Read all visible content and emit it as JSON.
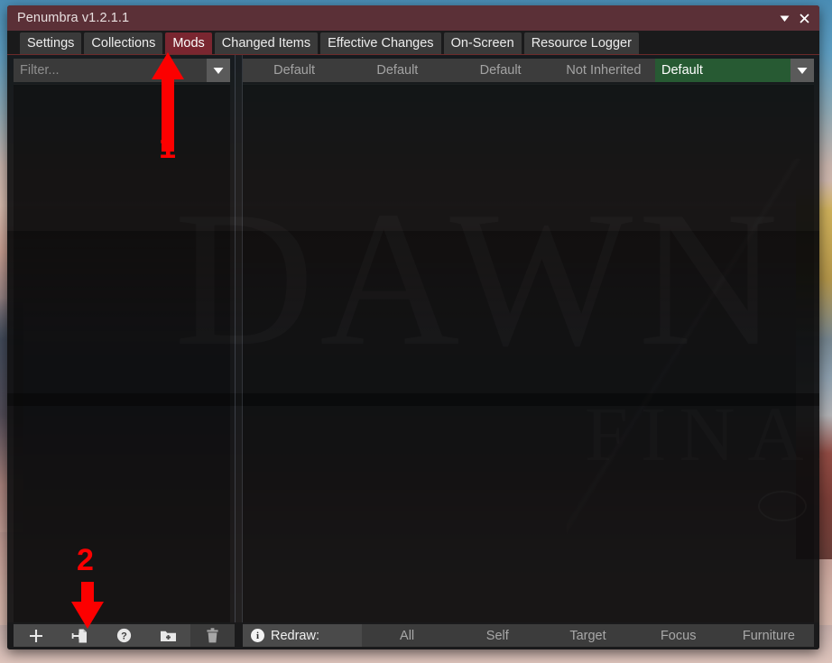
{
  "window": {
    "title": "Penumbra v1.2.1.1",
    "collapse_icon": "triangle-down-icon",
    "close_icon": "close-icon",
    "titlebar_color": "#5b3037"
  },
  "tabs": [
    {
      "label": "Settings",
      "active": false
    },
    {
      "label": "Collections",
      "active": false
    },
    {
      "label": "Mods",
      "active": true
    },
    {
      "label": "Changed Items",
      "active": false
    },
    {
      "label": "Effective Changes",
      "active": false
    },
    {
      "label": "On-Screen",
      "active": false
    },
    {
      "label": "Resource Logger",
      "active": false
    }
  ],
  "left_pane": {
    "filter": {
      "value": "",
      "placeholder": "Filter...",
      "dropdown_icon": "triangle-down-icon"
    },
    "mod_list_items": []
  },
  "right_pane": {
    "collection_headers": [
      "Default",
      "Default",
      "Default",
      "Not Inherited"
    ],
    "collection_selected": "Default",
    "collection_dropdown_icon": "triangle-down-icon",
    "collection_accent": "#275a33"
  },
  "bottom_bar": {
    "tools": [
      {
        "name": "add-mod-button",
        "icon": "plus-icon"
      },
      {
        "name": "import-mod-button",
        "icon": "import-file-icon"
      },
      {
        "name": "help-button",
        "icon": "question-circle-icon"
      },
      {
        "name": "new-folder-button",
        "icon": "folder-plus-icon"
      },
      {
        "name": "delete-mod-button",
        "icon": "trash-icon"
      }
    ],
    "redraw_label": "Redraw:",
    "redraw_info_icon": "info-icon",
    "redraw_buttons": [
      "All",
      "Self",
      "Target",
      "Focus",
      "Furniture"
    ]
  },
  "annotations": [
    {
      "number": "1",
      "target": "mods-tab",
      "direction": "up",
      "color": "#fc0000"
    },
    {
      "number": "2",
      "target": "import-mod-button",
      "direction": "down",
      "color": "#fc0000"
    }
  ],
  "background": {
    "watermark_primary": "DAWN",
    "watermark_secondary": "FINAL"
  }
}
